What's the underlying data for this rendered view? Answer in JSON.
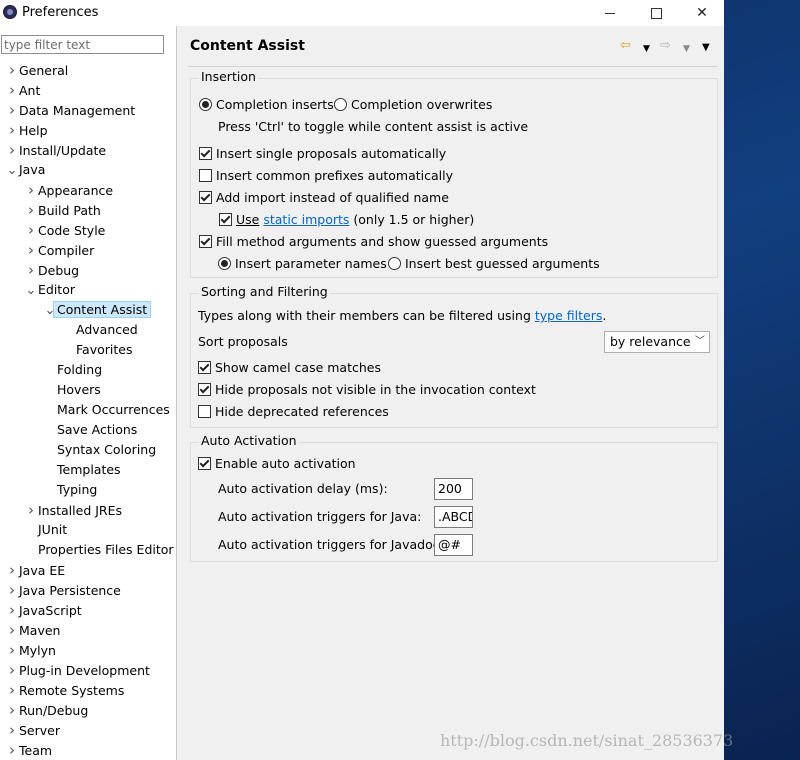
{
  "window": {
    "title": "Preferences"
  },
  "sidebar": {
    "filter_placeholder": "type filter text",
    "items": [
      {
        "label": "General",
        "indent": 0,
        "expander": ">"
      },
      {
        "label": "Ant",
        "indent": 0,
        "expander": ">"
      },
      {
        "label": "Data Management",
        "indent": 0,
        "expander": ">"
      },
      {
        "label": "Help",
        "indent": 0,
        "expander": ">"
      },
      {
        "label": "Install/Update",
        "indent": 0,
        "expander": ">"
      },
      {
        "label": "Java",
        "indent": 0,
        "expander": "v"
      },
      {
        "label": "Appearance",
        "indent": 1,
        "expander": ">"
      },
      {
        "label": "Build Path",
        "indent": 1,
        "expander": ">"
      },
      {
        "label": "Code Style",
        "indent": 1,
        "expander": ">"
      },
      {
        "label": "Compiler",
        "indent": 1,
        "expander": ">"
      },
      {
        "label": "Debug",
        "indent": 1,
        "expander": ">"
      },
      {
        "label": "Editor",
        "indent": 1,
        "expander": "v"
      },
      {
        "label": "Content Assist",
        "indent": 2,
        "expander": "v",
        "selected": true
      },
      {
        "label": "Advanced",
        "indent": 3,
        "expander": ""
      },
      {
        "label": "Favorites",
        "indent": 3,
        "expander": ""
      },
      {
        "label": "Folding",
        "indent": 2,
        "expander": ""
      },
      {
        "label": "Hovers",
        "indent": 2,
        "expander": ""
      },
      {
        "label": "Mark Occurrences",
        "indent": 2,
        "expander": ""
      },
      {
        "label": "Save Actions",
        "indent": 2,
        "expander": ""
      },
      {
        "label": "Syntax Coloring",
        "indent": 2,
        "expander": ""
      },
      {
        "label": "Templates",
        "indent": 2,
        "expander": ""
      },
      {
        "label": "Typing",
        "indent": 2,
        "expander": ""
      },
      {
        "label": "Installed JREs",
        "indent": 1,
        "expander": ">"
      },
      {
        "label": "JUnit",
        "indent": 1,
        "expander": ""
      },
      {
        "label": "Properties Files Editor",
        "indent": 1,
        "expander": ""
      },
      {
        "label": "Java EE",
        "indent": 0,
        "expander": ">"
      },
      {
        "label": "Java Persistence",
        "indent": 0,
        "expander": ">"
      },
      {
        "label": "JavaScript",
        "indent": 0,
        "expander": ">"
      },
      {
        "label": "Maven",
        "indent": 0,
        "expander": ">"
      },
      {
        "label": "Mylyn",
        "indent": 0,
        "expander": ">"
      },
      {
        "label": "Plug-in Development",
        "indent": 0,
        "expander": ">"
      },
      {
        "label": "Remote Systems",
        "indent": 0,
        "expander": ">"
      },
      {
        "label": "Run/Debug",
        "indent": 0,
        "expander": ">"
      },
      {
        "label": "Server",
        "indent": 0,
        "expander": ">"
      },
      {
        "label": "Team",
        "indent": 0,
        "expander": ">"
      }
    ]
  },
  "page": {
    "title": "Content Assist",
    "insertion": {
      "legend": "Insertion",
      "completion_inserts": "Completion inserts",
      "completion_overwrites": "Completion overwrites",
      "toggle_hint": "Press 'Ctrl' to toggle while content assist is active",
      "insert_single": "Insert single proposals automatically",
      "insert_common": "Insert common prefixes automatically",
      "add_import": "Add import instead of qualified name",
      "use_prefix": "Use",
      "static_imports": "static imports",
      "use_suffix": " (only 1.5 or higher)",
      "fill_method": "Fill method arguments and show guessed arguments",
      "insert_param_names": "Insert parameter names",
      "insert_best_guessed": "Insert best guessed arguments"
    },
    "sorting": {
      "legend": "Sorting and Filtering",
      "types_text": "Types along with their members can be filtered using ",
      "type_filters": "type filters",
      "types_end": ".",
      "sort_label": "Sort proposals",
      "sort_value": "by relevance",
      "camel_case": "Show camel case matches",
      "hide_not_visible": "Hide proposals not visible in the invocation context",
      "hide_deprecated": "Hide deprecated references"
    },
    "auto": {
      "legend": "Auto Activation",
      "enable": "Enable auto activation",
      "delay_label": "Auto activation delay (ms):",
      "delay_value": "200",
      "java_label": "Auto activation triggers for Java:",
      "java_value": ".ABCD",
      "javadoc_label": "Auto activation triggers for Javadoc:",
      "javadoc_value": "@#"
    }
  },
  "watermark": "http://blog.csdn.net/sinat_28536373",
  "colors": {
    "selection": "#cce8ff",
    "link": "#0066cc",
    "nav_back": "#e0a020"
  }
}
